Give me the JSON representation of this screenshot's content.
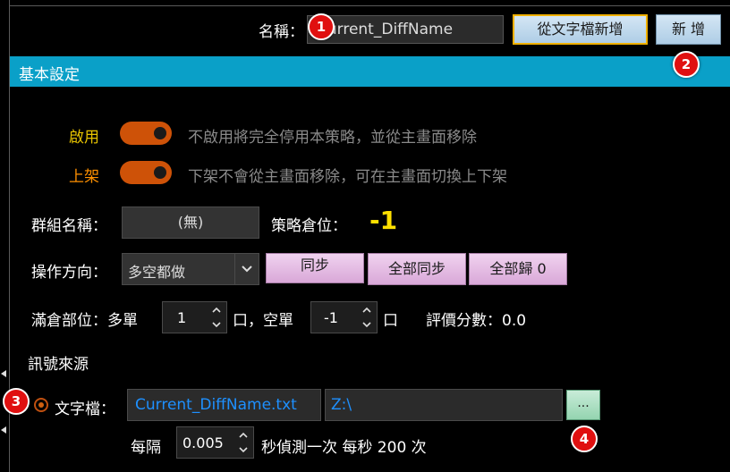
{
  "header": {
    "name_label": "名稱：",
    "name_value": "Current_DiffName",
    "add_from_text_label": "從文字檔新增",
    "add_label": "新 增"
  },
  "section": {
    "title": "基本設定"
  },
  "enable": {
    "label": "啟用",
    "enabled": true,
    "description": "不啟用將完全停用本策略，並從主畫面移除"
  },
  "listed": {
    "label": "上架",
    "enabled": true,
    "description": "下架不會從主畫面移除，可在主畫面切換上下架"
  },
  "group": {
    "label": "群組名稱：",
    "value": "(無)",
    "position_label": "策略倉位：",
    "position_value": "-1"
  },
  "direction": {
    "label": "操作方向：",
    "selected": "多空都做",
    "sync_label": "同步",
    "sync_all_label": "全部同步",
    "reset_all_label": "全部歸 0"
  },
  "full_position": {
    "label": "滿倉部位：多單",
    "long_value": "1",
    "long_unit": "口，空單",
    "short_value": "-1",
    "short_unit": "口",
    "score_label": "評價分數：0.0"
  },
  "signal": {
    "title": "訊號來源",
    "text_file_label": "文字檔：",
    "file_name": "Current_DiffName.txt",
    "folder": "Z:\\",
    "browse_label": "...",
    "interval_prefix": "每隔",
    "interval_value": "0.005",
    "interval_suffix": "秒偵測一次 每秒 200 次"
  },
  "badges": [
    "1",
    "2",
    "3",
    "4"
  ],
  "colors": {
    "section_bar": "#0aa0c8",
    "toggle_on": "#ce5208",
    "position_value": "#ffe000",
    "file_text": "#1e90ff",
    "badge": "#e01010"
  }
}
